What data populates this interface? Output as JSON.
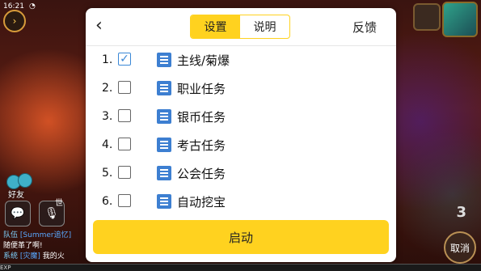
{
  "status_bar": {
    "time": "16:21"
  },
  "background": {
    "friends_label": "好友",
    "world_label": "世",
    "chat_lines": [
      {
        "tag": "队伍",
        "name": "[Summer追忆]",
        "text": ""
      },
      {
        "tag": "",
        "name": "",
        "text": "随便革了啊!"
      },
      {
        "tag": "系统",
        "name": "[灾魔]",
        "text": "我的火"
      }
    ],
    "exp_label": "EXP",
    "cancel_label": "取消",
    "side_number": "3"
  },
  "dialog": {
    "back_icon": "chevron-left-icon",
    "tabs": [
      {
        "label": "设置",
        "active": true
      },
      {
        "label": "说明",
        "active": false
      }
    ],
    "feedback_label": "反馈",
    "tasks": [
      {
        "index": "1.",
        "name": "主线/菊爆",
        "checked": true
      },
      {
        "index": "2.",
        "name": "职业任务",
        "checked": false
      },
      {
        "index": "3.",
        "name": "银币任务",
        "checked": false
      },
      {
        "index": "4.",
        "name": "考古任务",
        "checked": false
      },
      {
        "index": "5.",
        "name": "公会任务",
        "checked": false
      },
      {
        "index": "6.",
        "name": "自动挖宝",
        "checked": false
      }
    ],
    "task_icon": "list-icon",
    "start_label": "启动",
    "accent_color": "#ffd21f",
    "check_color": "#3a87d6"
  }
}
